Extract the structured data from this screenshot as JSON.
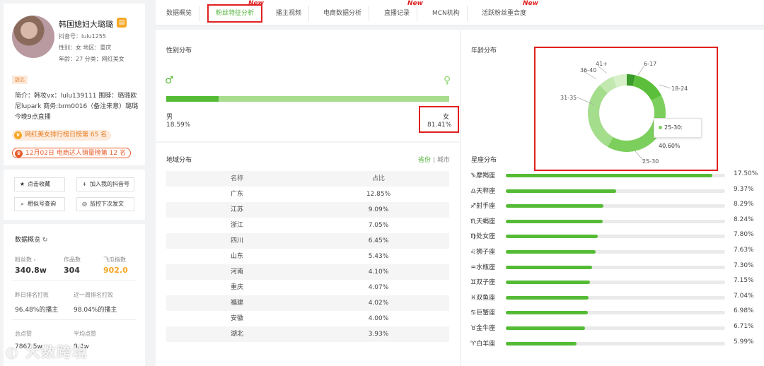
{
  "profile": {
    "name": "韩国媳妇大璐璐",
    "douyin_id": "抖音号：lulu1255",
    "gender_region": "性别：女  地区：重庆",
    "age_category": "年龄：27  分类：网红美女",
    "tag": "甜芯",
    "bio": "简介：韩妆vx：lulu139111 围脖：璐璐欧尼lupark 商务:brm0016（备注来意）璐璐今晚9点直播",
    "rank1": "网红美女排行榜日榜第 65 名",
    "rank2": "12月02日 电商达人销量榜第 12 名"
  },
  "actions": {
    "collect": "点击收藏",
    "add_account": "加入我的抖音号",
    "similar": "相似号查询",
    "monitor": "监控下次发文"
  },
  "overview": {
    "title": "数据概览",
    "fans_label": "粉丝数",
    "fans_value": "340.8w",
    "works_label": "作品数",
    "works_value": "304",
    "index_label": "飞瓜指数",
    "index_value": "902.0",
    "yesterday_label": "昨日排名打败",
    "yesterday_value": "96.48%的播主",
    "week_label": "近一周排名打败",
    "week_value": "98.04%的播主",
    "total_likes_label": "总点赞",
    "total_likes_value": "7867.5w",
    "avg_likes_label": "平均点赞",
    "avg_likes_value": "9.4w"
  },
  "watermark": "大数跨境",
  "tabs": [
    {
      "label": "数据概览",
      "new": false,
      "active": false
    },
    {
      "label": "粉丝特征分析",
      "new": true,
      "active": true
    },
    {
      "label": "播主视频",
      "new": false,
      "active": false
    },
    {
      "label": "电商数据分析",
      "new": false,
      "active": false
    },
    {
      "label": "直播记录",
      "new": true,
      "active": false
    },
    {
      "label": "MCN机构",
      "new": false,
      "active": false
    },
    {
      "label": "活跃粉丝重合度",
      "new": true,
      "active": false
    }
  ],
  "new_label": "New",
  "gender": {
    "title": "性别分布",
    "male_label": "男",
    "male_pct": "18.59%",
    "female_label": "女",
    "female_pct": "81.41%",
    "male_value": 18.59
  },
  "region": {
    "title": "地域分布",
    "toggle_on": "省份",
    "toggle_sep": "|",
    "toggle_off": "城市",
    "col_name": "名称",
    "col_pct": "占比",
    "rows": [
      {
        "name": "广东",
        "pct": "12.85%"
      },
      {
        "name": "江苏",
        "pct": "9.09%"
      },
      {
        "name": "浙江",
        "pct": "7.05%"
      },
      {
        "name": "四川",
        "pct": "6.45%"
      },
      {
        "name": "山东",
        "pct": "5.43%"
      },
      {
        "name": "河南",
        "pct": "4.10%"
      },
      {
        "name": "重庆",
        "pct": "4.07%"
      },
      {
        "name": "福建",
        "pct": "4.02%"
      },
      {
        "name": "安徽",
        "pct": "4.00%"
      },
      {
        "name": "湖北",
        "pct": "3.93%"
      }
    ]
  },
  "age": {
    "title": "年龄分布",
    "tooltip": "25-30: 40.60%"
  },
  "zodiac": {
    "title": "星座分布"
  },
  "chart_data": [
    {
      "type": "pie",
      "title": "年龄分布",
      "categories": [
        "6-17",
        "18-24",
        "25-30",
        "31-35",
        "36-40",
        "41+"
      ],
      "values": [
        3.5,
        14.0,
        40.6,
        29.5,
        6.4,
        6.0
      ],
      "colors": [
        "#3a9a2a",
        "#5cbf3c",
        "#7ccf5c",
        "#a4dd8c",
        "#c2e8b0",
        "#d6f0c8"
      ]
    },
    {
      "type": "bar",
      "title": "星座分布",
      "categories": [
        "摩羯座",
        "天秤座",
        "射手座",
        "天蝎座",
        "处女座",
        "狮子座",
        "水瓶座",
        "双子座",
        "双鱼座",
        "巨蟹座",
        "金牛座",
        "白羊座"
      ],
      "symbols": [
        "♑",
        "♎",
        "♐",
        "♏",
        "♍",
        "♌",
        "♒",
        "♊",
        "♓",
        "♋",
        "♉",
        "♈"
      ],
      "labels": [
        "17.50%",
        "9.37%",
        "8.29%",
        "8.24%",
        "7.80%",
        "7.63%",
        "7.30%",
        "7.15%",
        "7.04%",
        "6.98%",
        "6.71%",
        "5.99%"
      ],
      "values": [
        17.5,
        9.37,
        8.29,
        8.24,
        7.8,
        7.63,
        7.3,
        7.15,
        7.04,
        6.98,
        6.71,
        5.99
      ],
      "xlim": [
        0,
        18.6
      ]
    }
  ]
}
